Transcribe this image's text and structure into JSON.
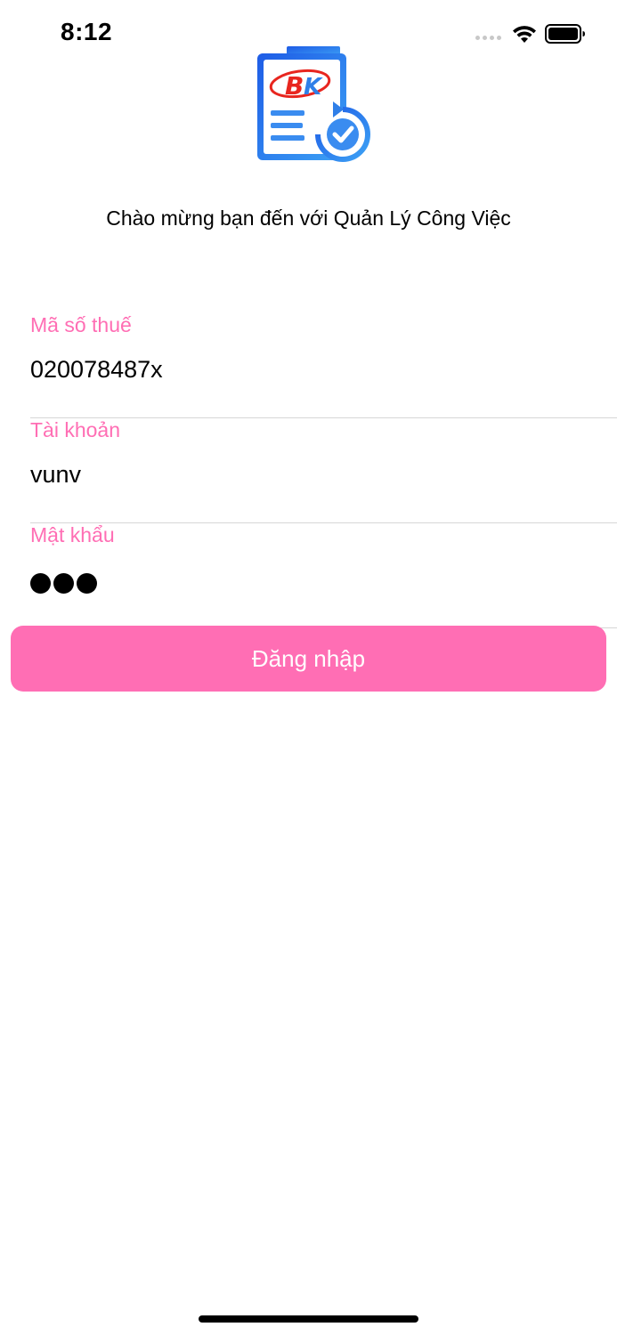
{
  "status_bar": {
    "time": "8:12",
    "icons": [
      "signal-dots-icon",
      "wifi-icon",
      "battery-icon"
    ]
  },
  "logo": {
    "icon": "clipboard-refresh-check-logo",
    "text": "BK"
  },
  "welcome": {
    "text": "Chào mừng bạn đến với Quản Lý Công Việc"
  },
  "form": {
    "tax_code": {
      "label": "Mã số thuế",
      "value": "020078487x"
    },
    "account": {
      "label": "Tài khoản",
      "value": "vunv"
    },
    "password": {
      "label": "Mật khẩu",
      "masked_length": 3
    }
  },
  "login_button": {
    "label": "Đăng nhập"
  },
  "colors": {
    "accent": "#ff6eb4",
    "divider": "#d6d6d6",
    "logo_blue": "#2f7fe8",
    "logo_red": "#e8261f"
  }
}
